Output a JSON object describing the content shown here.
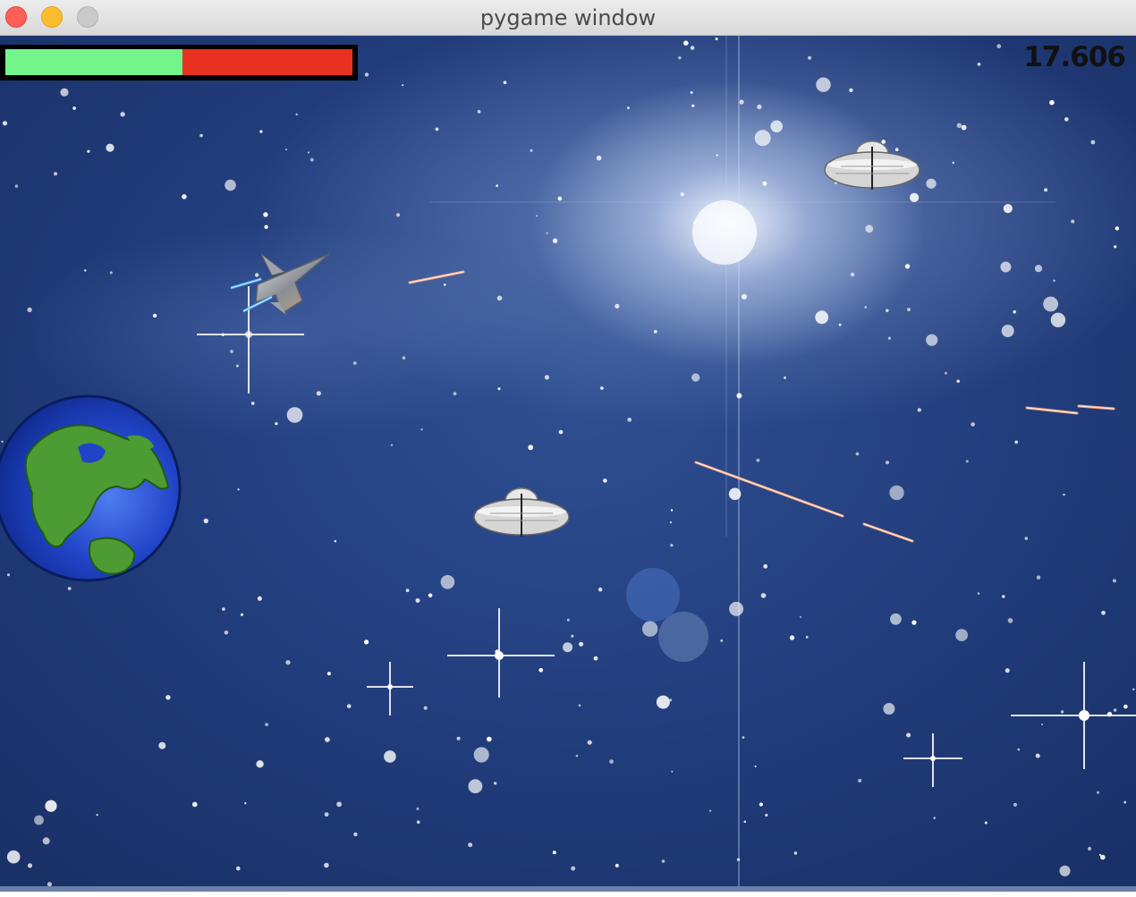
{
  "window": {
    "title": "pygame window"
  },
  "hud": {
    "health_fraction": 0.51,
    "health_fill_color": "#72f58a",
    "health_empty_color": "#e8321f",
    "score": "17.606"
  },
  "icons": {
    "close": "close-icon",
    "minimize": "minimize-icon",
    "maximize": "maximize-icon",
    "player": "fighter-jet-icon",
    "enemy": "ufo-icon",
    "base": "earth-icon",
    "projectile": "laser-bolt-icon"
  }
}
